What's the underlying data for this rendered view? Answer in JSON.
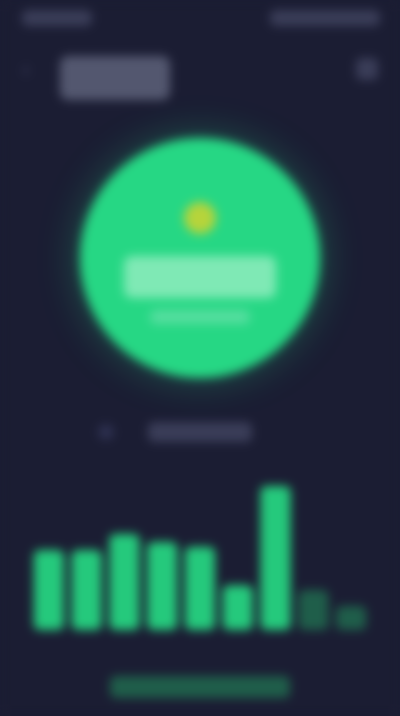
{
  "status_bar": {
    "time": "",
    "icons": ""
  },
  "header": {
    "back_icon": "chevron-left-icon",
    "title": "",
    "menu_icon": "menu-icon"
  },
  "score_card": {
    "icon": "sun-icon",
    "icon_color": "#b6d43b",
    "value": "",
    "caption": "",
    "color": "#26d784"
  },
  "status_row": {
    "label": ""
  },
  "chart_data": {
    "type": "bar",
    "title": "",
    "xlabel": "",
    "ylabel": "",
    "categories": [
      "",
      "",
      "",
      "",
      "",
      "",
      "",
      "",
      ""
    ],
    "values": [
      0.5,
      0.5,
      0.6,
      0.55,
      0.52,
      0.28,
      0.9,
      0.25,
      0.15
    ],
    "highlight": [
      true,
      true,
      true,
      true,
      true,
      true,
      true,
      false,
      false
    ],
    "ylim": [
      0,
      1
    ],
    "bar_color": "#25c97c",
    "dim_color": "#1f5e4a"
  },
  "bottom_link": {
    "label": ""
  },
  "colors": {
    "background": "#1b1d33",
    "accent": "#26d784"
  }
}
